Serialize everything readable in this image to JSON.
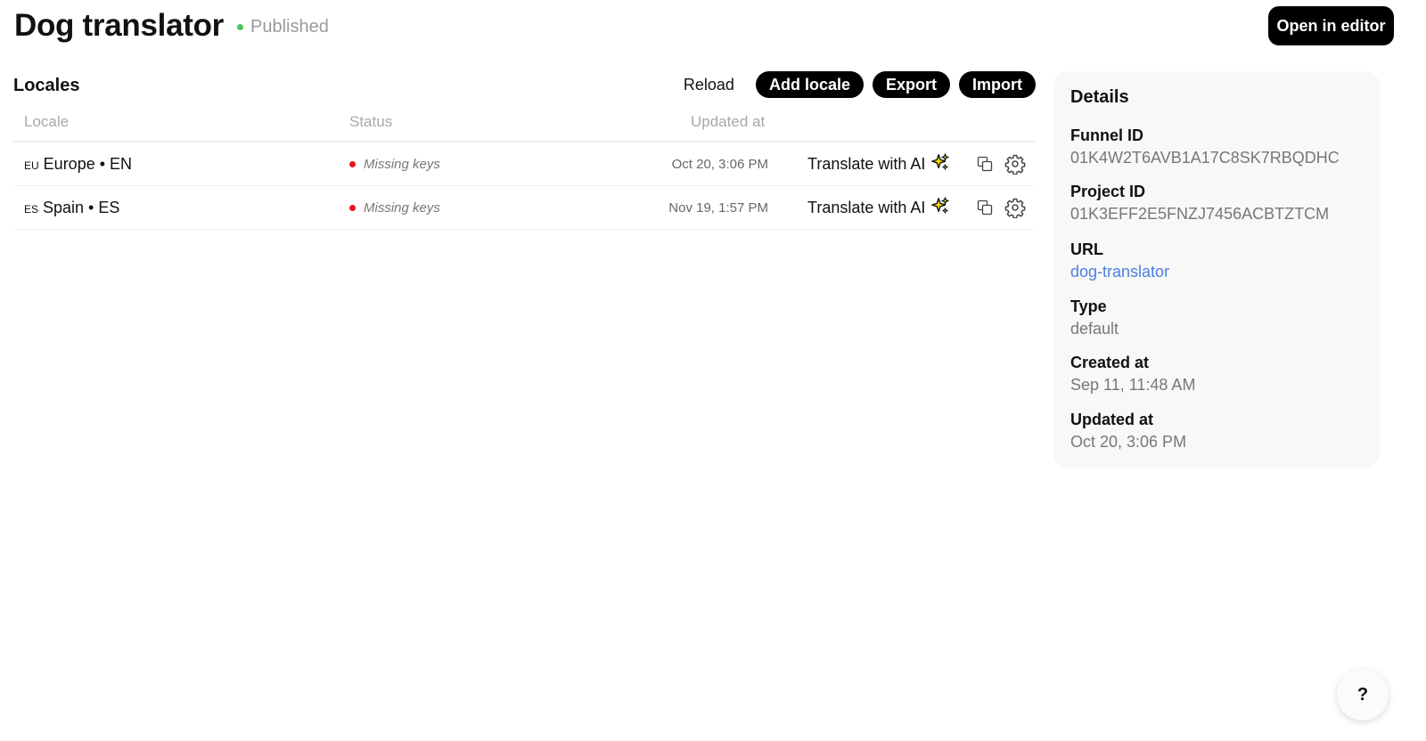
{
  "header": {
    "title": "Dog translator",
    "status": "Published",
    "open_editor_label": "Open in editor"
  },
  "locales": {
    "title": "Locales",
    "actions": {
      "reload": "Reload",
      "add_locale": "Add locale",
      "export": "Export",
      "import": "Import"
    },
    "columns": {
      "locale": "Locale",
      "status": "Status",
      "updated_at": "Updated at"
    },
    "rows": [
      {
        "code": "EU",
        "name": "Europe • EN",
        "status": "Missing keys",
        "updated_at": "Oct 20, 3:06 PM",
        "translate_label": "Translate with AI"
      },
      {
        "code": "ES",
        "name": "Spain • ES",
        "status": "Missing keys",
        "updated_at": "Nov 19, 1:57 PM",
        "translate_label": "Translate with AI"
      }
    ]
  },
  "details": {
    "title": "Details",
    "funnel_id": {
      "label": "Funnel ID",
      "value": "01K4W2T6AVB1A17C8SK7RBQDHC"
    },
    "project_id": {
      "label": "Project ID",
      "value": "01K3EFF2E5FNZJ7456ACBTZTCM"
    },
    "url": {
      "label": "URL",
      "value": "dog-translator"
    },
    "type": {
      "label": "Type",
      "value": "default"
    },
    "created_at": {
      "label": "Created at",
      "value": "Sep 11, 11:48 AM"
    },
    "updated_at": {
      "label": "Updated at",
      "value": "Oct 20, 3:06 PM"
    }
  },
  "help": {
    "label": "?"
  },
  "colors": {
    "published": "#4cc85a",
    "missing": "#e8141a",
    "link": "#4d7ee0",
    "sparkle": "#f5d90a"
  },
  "icons": [
    "sparkles-icon",
    "copy-icon",
    "gear-icon"
  ]
}
